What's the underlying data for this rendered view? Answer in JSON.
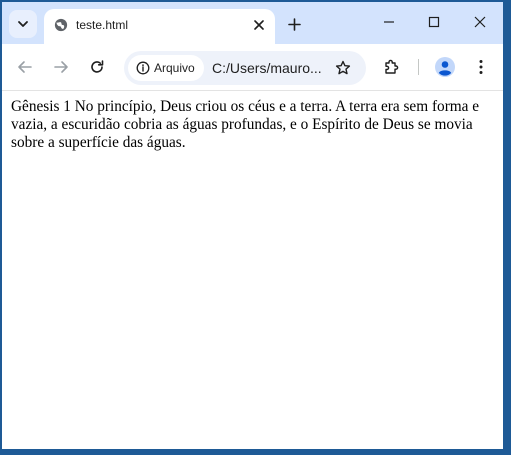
{
  "tabstrip": {
    "tab": {
      "title": "teste.html"
    }
  },
  "toolbar": {
    "omnibox": {
      "chip_label": "Arquivo",
      "url": "C:/Users/mauro..."
    }
  },
  "page": {
    "text": "Gênesis 1 No princípio, Deus criou os céus e a terra. A terra era sem forma e vazia, a escuridão cobria as águas profundas, e o Espírito de Deus se movia sobre a superfície das águas."
  },
  "colors": {
    "desktop": "#1e5a96",
    "tabstrip": "#d3e3fd",
    "omnibox": "#eef2fa",
    "profile_accent": "#0b57d0"
  },
  "icons": [
    "tab-search-icon",
    "globe-icon",
    "close-icon",
    "plus-icon",
    "minimize-icon",
    "maximize-icon",
    "window-close-icon",
    "back-arrow-icon",
    "forward-arrow-icon",
    "reload-icon",
    "info-icon",
    "star-icon",
    "extensions-icon",
    "profile-icon",
    "more-vert-icon"
  ]
}
